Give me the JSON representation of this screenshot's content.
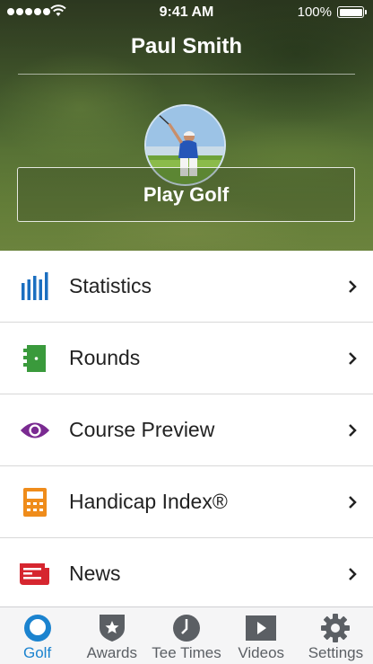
{
  "status_bar": {
    "time": "9:41 AM",
    "battery": "100%"
  },
  "header": {
    "user_name": "Paul Smith",
    "avatar_icon": "golfer-photo",
    "play_button": "Play Golf"
  },
  "menu": [
    {
      "label": "Statistics",
      "icon": "bar-chart-icon",
      "color": "#1b6fc0"
    },
    {
      "label": "Rounds",
      "icon": "scorecard-icon",
      "color": "#3a9a3c"
    },
    {
      "label": "Course Preview",
      "icon": "eye-icon",
      "color": "#7a2a91"
    },
    {
      "label": "Handicap Index®",
      "icon": "calculator-icon",
      "color": "#ef8c1b"
    },
    {
      "label": "News",
      "icon": "newspaper-icon",
      "color": "#d6262f"
    }
  ],
  "tabs": [
    {
      "label": "Golf",
      "icon": "golf-ball-icon",
      "active": true
    },
    {
      "label": "Awards",
      "icon": "award-shield-icon",
      "active": false
    },
    {
      "label": "Tee Times",
      "icon": "clock-icon",
      "active": false
    },
    {
      "label": "Videos",
      "icon": "play-icon",
      "active": false
    },
    {
      "label": "Settings",
      "icon": "gear-icon",
      "active": false
    }
  ],
  "colors": {
    "accent": "#1b83cf",
    "tab_inactive": "#5b5f64"
  }
}
